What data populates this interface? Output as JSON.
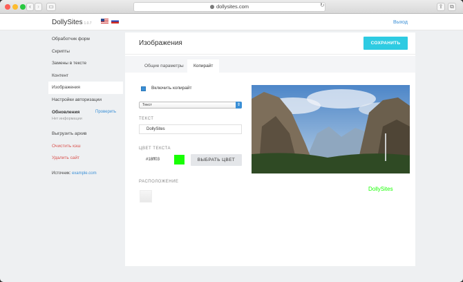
{
  "browser": {
    "url": "dollysites.com"
  },
  "header": {
    "logo": "DollySites",
    "version": "1.0.7",
    "logout": "Выход"
  },
  "sidebar": {
    "items": [
      {
        "label": "Обработчик форм"
      },
      {
        "label": "Скрипты"
      },
      {
        "label": "Замены в тексте"
      },
      {
        "label": "Контент"
      },
      {
        "label": "Изображения",
        "active": true
      },
      {
        "label": "Настройки авторизации"
      }
    ],
    "updates": {
      "title": "Обновления",
      "check": "Проверить",
      "status": "Нет информации"
    },
    "actions": {
      "download": "Выгрузить архив",
      "clear_cache": "Очистить кэш",
      "delete_site": "Удалить сайт"
    },
    "source": {
      "label": "Источник:",
      "link": "example.com"
    }
  },
  "main": {
    "title": "Изображения",
    "save_label": "СОХРАНИТЬ",
    "tabs": [
      {
        "label": "Общие параметры"
      },
      {
        "label": "Копирайт",
        "active": true
      }
    ],
    "copyright": {
      "enable_label": "Включить копирайт",
      "type_value": "Текст",
      "text_label": "ТЕКСТ",
      "text_value": "DollySites",
      "color_label": "ЦВЕТ ТЕКСТА",
      "color_value": "#18ff03",
      "choose_color_label": "ВЫБРАТЬ ЦВЕТ",
      "position_label": "РАСПОЛОЖЕНИЕ",
      "preview_watermark": "DollySites"
    }
  },
  "colors": {
    "accent": "#2ecbe2",
    "link": "#3a8fd6",
    "danger": "#d9534f",
    "watermark": "#18ff03"
  }
}
